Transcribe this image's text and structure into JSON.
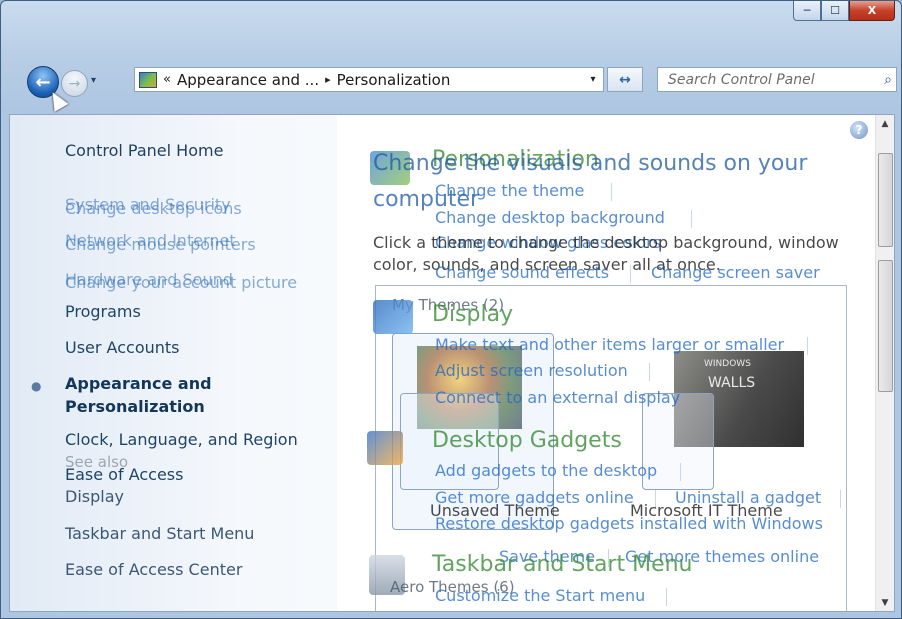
{
  "window": {
    "caption_buttons": {
      "minimize": "─",
      "maximize": "☐",
      "close": "X"
    }
  },
  "nav": {
    "back_glyph": "←",
    "forward_glyph": "→",
    "recent_glyph": "▾",
    "address": {
      "overflow": "«",
      "crumb1": "Appearance and ...",
      "sep": "▸",
      "crumb2": "Personalization",
      "dropdown": "▾"
    },
    "refresh_glyph": "↔",
    "search_placeholder": "Search Control Panel",
    "search_icon_glyph": "⌕"
  },
  "left_pane": {
    "home": "Control Panel Home",
    "overlapped": [
      {
        "label": "System and Security"
      },
      {
        "label": "Change desktop icons"
      },
      {
        "label": "Network and Internet"
      },
      {
        "label": "Change mouse pointers"
      },
      {
        "label": "Hardware and Sound"
      },
      {
        "label": "Change your account picture"
      }
    ],
    "items": [
      {
        "label": "Programs"
      },
      {
        "label": "User Accounts"
      }
    ],
    "active": {
      "line1": "Appearance and",
      "line2": "Personalization",
      "bullet": "●"
    },
    "clock": "Clock, Language, and Region",
    "see_also": "See also",
    "ease": "Ease of Access",
    "see_also_items": [
      "Display",
      "Taskbar and Start Menu",
      "Ease of Access Center"
    ]
  },
  "right_pane": {
    "help_glyph": "?",
    "main_heading_1": "Change the visuals and sounds on your",
    "main_heading_2": "computer",
    "main_desc_1": "Click a theme to change the desktop background, window",
    "main_desc_2": "color, sounds, and screen saver all at once.",
    "personalization": {
      "title": "Personalization",
      "links": [
        "Change the theme",
        "Change desktop background",
        "Change window glass colors",
        "Change sound effects",
        "Change screen saver"
      ]
    },
    "my_themes": "My Themes (2)",
    "display": {
      "title": "Display",
      "links": [
        "Make text and other items larger or smaller",
        "Adjust screen resolution",
        "Connect to an external display"
      ]
    },
    "gadgets": {
      "title": "Desktop Gadgets",
      "links": [
        "Add gadgets to the desktop",
        "Get more gadgets online",
        "Uninstall a gadget",
        "Restore desktop gadgets installed with Windows"
      ]
    },
    "themes": [
      {
        "label": "Unsaved Theme"
      },
      {
        "label": "Microsoft IT Theme"
      }
    ],
    "thumb2_text": {
      "line1": "WINDOWS",
      "line2": "WALLS"
    },
    "theme_actions": {
      "save": "Save theme",
      "more": "Get more themes online"
    },
    "taskbar": {
      "title": "Taskbar and Start Menu",
      "links": [
        "Customize the Start menu"
      ]
    },
    "aero": "Aero Themes (6)"
  },
  "scrollbar": {
    "up": "▲",
    "down": "▼"
  }
}
